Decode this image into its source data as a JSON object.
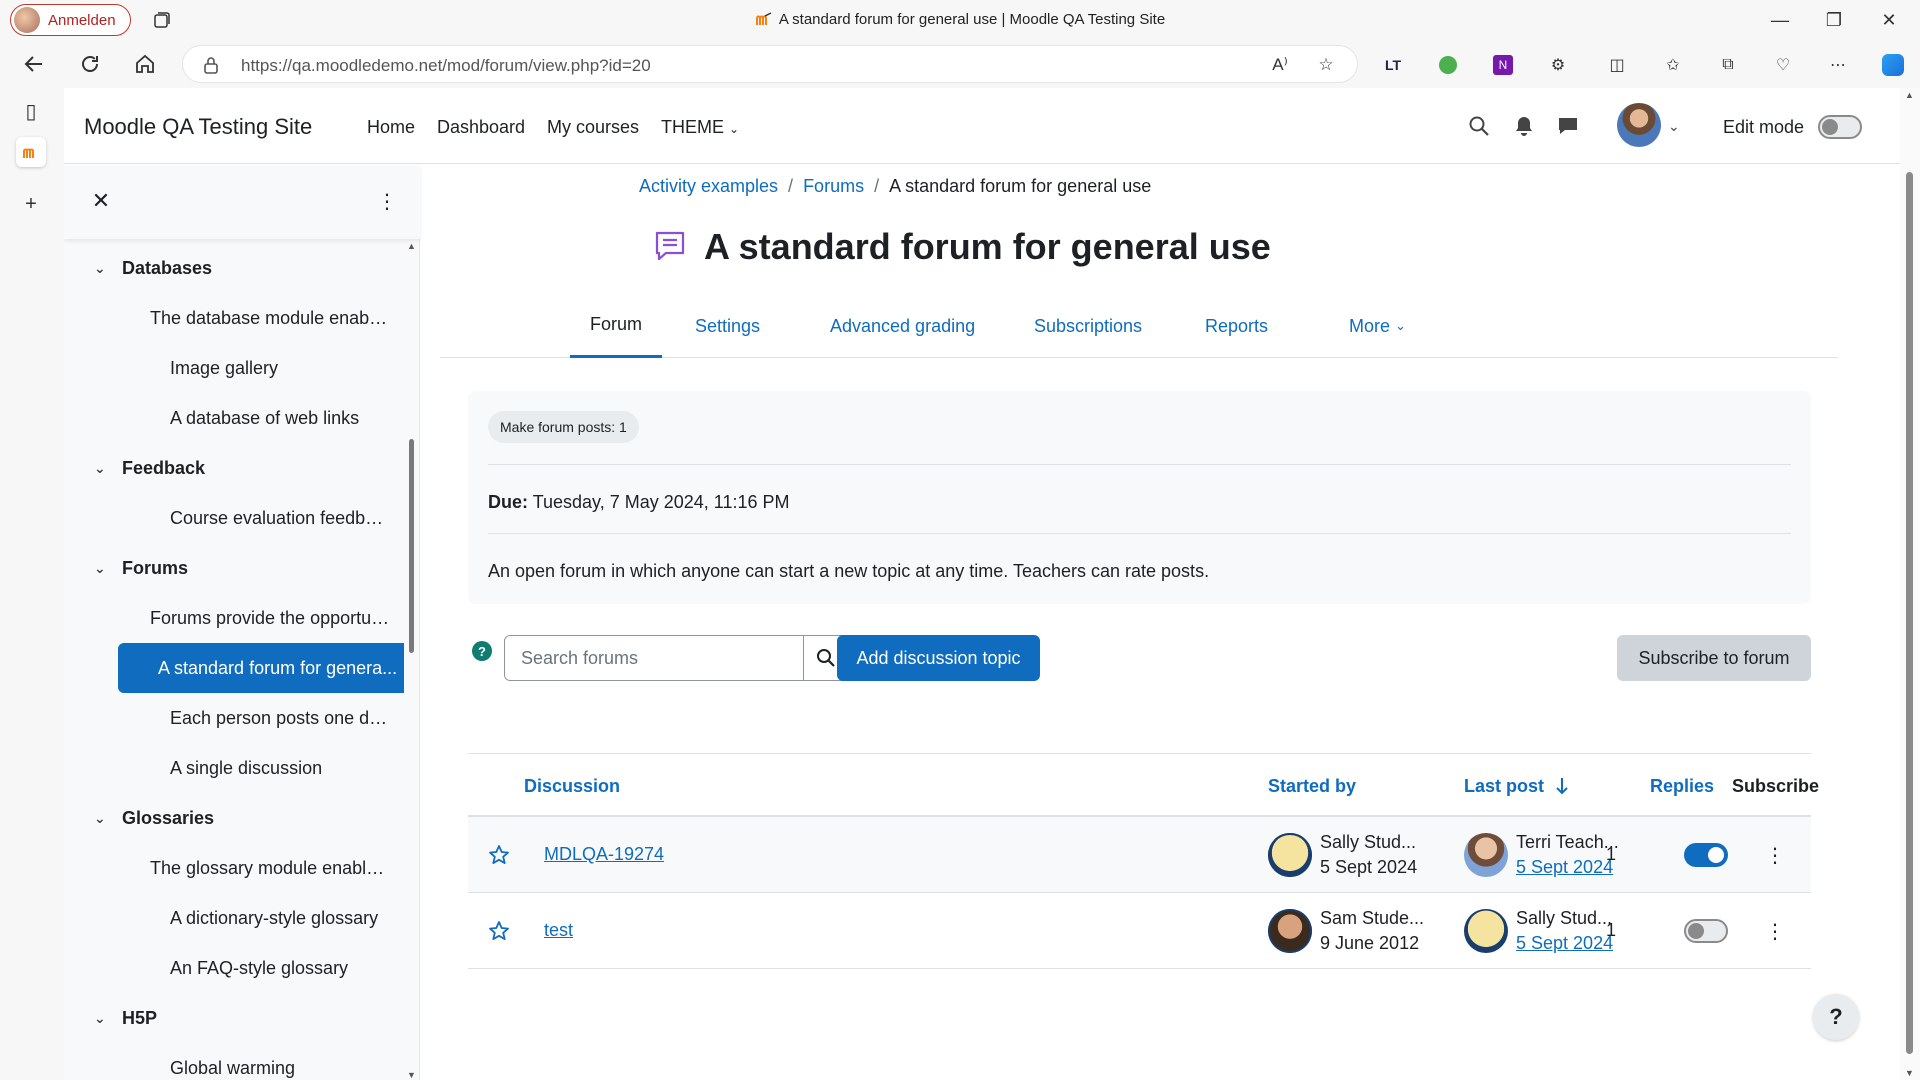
{
  "browser": {
    "profile_label": "Anmelden",
    "window_title": "A standard forum for general use | Moodle QA Testing Site",
    "url": "https://qa.moodledemo.net/mod/forum/view.php?id=20",
    "icons": [
      "back-icon",
      "refresh-icon",
      "home-icon",
      "lock-icon",
      "read-aloud-icon",
      "favorite-icon",
      "extensions-icon",
      "split-screen-icon",
      "favorites-icon",
      "collections-icon",
      "performance-icon",
      "more-icon",
      "copilot-icon"
    ]
  },
  "header": {
    "site_name": "Moodle QA Testing Site",
    "nav": [
      "Home",
      "Dashboard",
      "My courses",
      "THEME"
    ],
    "edit_mode_label": "Edit mode",
    "edit_mode_on": false
  },
  "course_index": {
    "items": [
      {
        "label": "Databases",
        "type": "section"
      },
      {
        "label": "The database module enables ...",
        "type": "activity-lvl1"
      },
      {
        "label": "Image gallery",
        "type": "activity"
      },
      {
        "label": "A database of web links",
        "type": "activity"
      },
      {
        "label": "Feedback",
        "type": "section"
      },
      {
        "label": "Course evaluation feedback",
        "type": "activity"
      },
      {
        "label": "Forums",
        "type": "section"
      },
      {
        "label": "Forums provide the opportunit...",
        "type": "activity-lvl1"
      },
      {
        "label": "A standard forum for genera...",
        "type": "activity",
        "active": true
      },
      {
        "label": "Each person posts one discu...",
        "type": "activity"
      },
      {
        "label": "A single discussion",
        "type": "activity"
      },
      {
        "label": "Glossaries",
        "type": "section"
      },
      {
        "label": "The glossary module enables p...",
        "type": "activity-lvl1"
      },
      {
        "label": "A dictionary-style glossary",
        "type": "activity"
      },
      {
        "label": "An FAQ-style glossary",
        "type": "activity"
      },
      {
        "label": "H5P",
        "type": "section"
      },
      {
        "label": "Global warming",
        "type": "activity"
      }
    ]
  },
  "breadcrumb": [
    "Activity examples",
    "Forums",
    "A standard forum for general use"
  ],
  "page_title": "A standard forum for general use",
  "secondary_nav": [
    {
      "label": "Forum",
      "active": true
    },
    {
      "label": "Settings"
    },
    {
      "label": "Advanced grading"
    },
    {
      "label": "Subscriptions"
    },
    {
      "label": "Reports"
    },
    {
      "label": "More"
    }
  ],
  "activity": {
    "completion": "Make forum posts: 1",
    "due_label": "Due:",
    "due_value": "Tuesday, 7 May 2024, 11:16 PM",
    "description": "An open forum in which anyone can start a new topic at any time. Teachers can rate posts."
  },
  "controls": {
    "search_placeholder": "Search forums",
    "add_topic": "Add discussion topic",
    "subscribe": "Subscribe to forum"
  },
  "table": {
    "headers": {
      "discussion": "Discussion",
      "started_by": "Started by",
      "last_post": "Last post",
      "replies": "Replies",
      "subscribe": "Subscribe"
    },
    "rows": [
      {
        "title": "MDLQA-19274",
        "starter": "Sally Stud...",
        "start_date": "5 Sept 2024",
        "last_user": "Terri Teach...",
        "last_date": "5 Sept 2024",
        "replies": "1",
        "subscribed": true
      },
      {
        "title": "test",
        "starter": "Sam Stude...",
        "start_date": "9 June 2012",
        "last_user": "Sally Stud...",
        "last_date": "5 Sept 2024",
        "replies": "1",
        "subscribed": false
      }
    ]
  },
  "help_fab": "?",
  "colors": {
    "primary": "#0f6cbf",
    "active_bg": "#0f6cbf"
  }
}
